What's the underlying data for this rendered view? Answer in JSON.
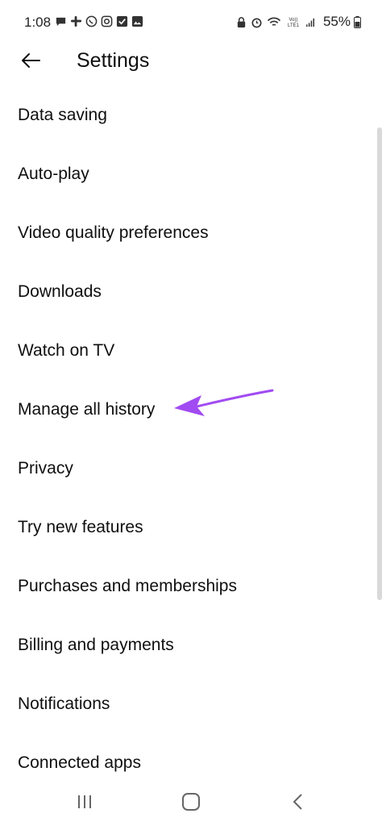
{
  "status_bar": {
    "time": "1:08",
    "battery": "55%",
    "left_icons": [
      "chat-bubble-icon",
      "slack-icon",
      "whatsapp-icon",
      "instagram-icon",
      "checkbox-icon",
      "gallery-icon"
    ],
    "right_icons": [
      "lock-icon",
      "alarm-icon",
      "wifi-icon",
      "volte-icon",
      "signal-icon",
      "battery-icon"
    ],
    "volte_label": "VoLTE1"
  },
  "header": {
    "title": "Settings",
    "back_icon": "arrow-left-icon"
  },
  "settings": {
    "items": [
      {
        "label": "Data saving"
      },
      {
        "label": "Auto-play"
      },
      {
        "label": "Video quality preferences"
      },
      {
        "label": "Downloads"
      },
      {
        "label": "Watch on TV"
      },
      {
        "label": "Manage all history"
      },
      {
        "label": "Privacy"
      },
      {
        "label": "Try new features"
      },
      {
        "label": "Purchases and memberships"
      },
      {
        "label": "Billing and payments"
      },
      {
        "label": "Notifications"
      },
      {
        "label": "Connected apps"
      }
    ]
  },
  "annotation": {
    "icon": "purple-arrow-icon",
    "color": "#a14bf2",
    "points_to": "Manage all history"
  },
  "nav_bar": {
    "icons": [
      "recents-icon",
      "home-icon",
      "back-icon"
    ]
  }
}
